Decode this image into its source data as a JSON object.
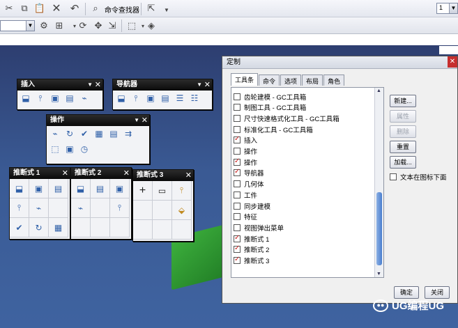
{
  "toolbar": {
    "command_finder_label": "命令查找器",
    "right_combo_value": "1"
  },
  "floating_toolbars": {
    "insert": {
      "title": "插入"
    },
    "navigator": {
      "title": "导航器"
    },
    "operation": {
      "title": "操作"
    },
    "push1": {
      "title": "推断式 1"
    },
    "push2": {
      "title": "推断式 2"
    },
    "push3": {
      "title": "推断式 3"
    }
  },
  "dialog": {
    "title": "定制",
    "tabs": [
      "工具条",
      "命令",
      "选项",
      "布局",
      "角色"
    ],
    "items": [
      {
        "label": "齿轮建模 - GC工具箱",
        "checked": false
      },
      {
        "label": "制图工具 - GC工具箱",
        "checked": false
      },
      {
        "label": "尺寸快速格式化工具 - GC工具箱",
        "checked": false
      },
      {
        "label": "标准化工具 - GC工具箱",
        "checked": false
      },
      {
        "label": "插入",
        "checked": true
      },
      {
        "label": "操作",
        "checked": false
      },
      {
        "label": "操作",
        "checked": true
      },
      {
        "label": "导航器",
        "checked": true
      },
      {
        "label": "几何体",
        "checked": false
      },
      {
        "label": "工件",
        "checked": false
      },
      {
        "label": "同步建模",
        "checked": false
      },
      {
        "label": "特征",
        "checked": false
      },
      {
        "label": "视图弹出菜单",
        "checked": false
      },
      {
        "label": "推断式 1",
        "checked": true
      },
      {
        "label": "推断式 2",
        "checked": true
      },
      {
        "label": "推断式 3",
        "checked": true
      }
    ],
    "buttons": {
      "new": "新建...",
      "properties": "属性",
      "delete": "删除",
      "reset": "重置",
      "load": "加载..."
    },
    "text_below_icon_label": "文本在图标下面",
    "ok": "确定",
    "close": "关闭"
  },
  "watermark": "UG编程UG"
}
